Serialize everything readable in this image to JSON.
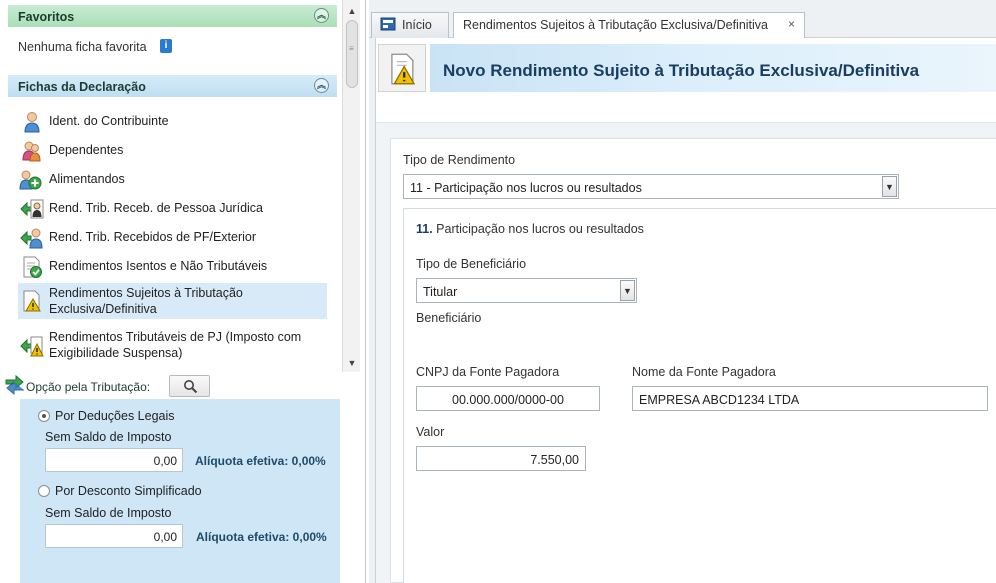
{
  "sidebar": {
    "favorites": {
      "title": "Favoritos",
      "empty_text": "Nenhuma ficha favorita"
    },
    "fichas": {
      "title": "Fichas da Declaração",
      "items": [
        {
          "label": "Ident. do Contribuinte",
          "icon": "person-icon"
        },
        {
          "label": "Dependentes",
          "icon": "people-icon"
        },
        {
          "label": "Alimentandos",
          "icon": "person-add-icon"
        },
        {
          "label": "Rend. Trib. Receb. de Pessoa Jurídica",
          "icon": "arrow-person-icon"
        },
        {
          "label": "Rend. Trib. Recebidos de PF/Exterior",
          "icon": "arrow-person-icon"
        },
        {
          "label": "Rendimentos Isentos e Não Tributáveis",
          "icon": "document-check-icon"
        },
        {
          "label": "Rendimentos Sujeitos à Tributação Exclusiva/Definitiva",
          "icon": "document-warning-icon",
          "selected": true
        },
        {
          "label": "Rendimentos Tributáveis de PJ (Imposto com Exigibilidade Suspensa)",
          "icon": "arrow-warning-icon"
        }
      ]
    }
  },
  "tributacao": {
    "title": "Opção pela Tributação:",
    "options": [
      {
        "label": "Por Deduções Legais",
        "selected": true,
        "saldo_label": "Sem Saldo de Imposto",
        "value": "0,00",
        "aliquota": "Alíquota efetiva: 0,00%"
      },
      {
        "label": "Por Desconto Simplificado",
        "selected": false,
        "saldo_label": "Sem Saldo de Imposto",
        "value": "0,00",
        "aliquota": "Alíquota efetiva: 0,00%"
      }
    ]
  },
  "tabs": {
    "home": "Início",
    "active": "Rendimentos Sujeitos à Tributação Exclusiva/Definitiva",
    "close_glyph": "×"
  },
  "page": {
    "title": "Novo Rendimento Sujeito à Tributação Exclusiva/Definitiva"
  },
  "form": {
    "tipo_rendimento_label": "Tipo de Rendimento",
    "tipo_rendimento_value": "11 - Participação nos lucros ou resultados",
    "detail_number": "11.",
    "detail_title": "Participação nos lucros ou resultados",
    "tipo_beneficiario_label": "Tipo de Beneficiário",
    "tipo_beneficiario_value": "Titular",
    "beneficiario_label": "Beneficiário",
    "cnpj_label": "CNPJ da Fonte Pagadora",
    "cnpj_value": "00.000.000/0000-00",
    "nome_label": "Nome da Fonte Pagadora",
    "nome_value": "EMPRESA ABCD1234 LTDA",
    "valor_label": "Valor",
    "valor_value": "7.550,00"
  },
  "colors": {
    "favorites_header": "#a9dfb8",
    "fichas_header": "#bfdef2",
    "selected_item": "#d8eaf7",
    "options_panel": "#cfe6f6",
    "title_text": "#1a3d63"
  }
}
